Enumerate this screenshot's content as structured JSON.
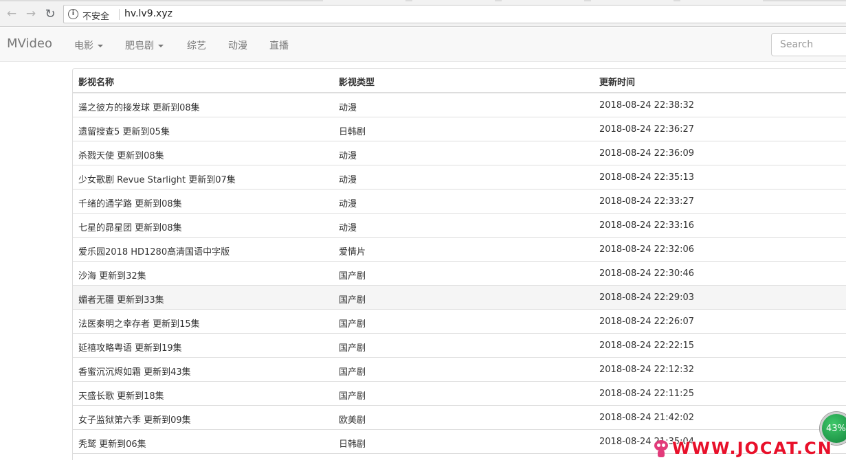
{
  "browser": {
    "back_icon": "back-arrow-icon",
    "forward_icon": "forward-arrow-icon",
    "reload_icon": "reload-icon",
    "security_label": "不安全",
    "url": "hv.lv9.xyz"
  },
  "navbar": {
    "brand": "MVideo",
    "items": [
      {
        "label": "电影",
        "dropdown": true
      },
      {
        "label": "肥皂剧",
        "dropdown": true
      },
      {
        "label": "综艺",
        "dropdown": false
      },
      {
        "label": "动漫",
        "dropdown": false
      },
      {
        "label": "直播",
        "dropdown": false
      }
    ],
    "search_placeholder": "Search"
  },
  "table": {
    "headers": [
      "影视名称",
      "影视类型",
      "更新时间"
    ],
    "rows": [
      {
        "name": "遥之彼方的接发球 更新到08集",
        "type": "动漫",
        "time": "2018-08-24 22:38:32"
      },
      {
        "name": "遗留搜查5 更新到05集",
        "type": "日韩剧",
        "time": "2018-08-24 22:36:27"
      },
      {
        "name": "杀戮天使 更新到08集",
        "type": "动漫",
        "time": "2018-08-24 22:36:09"
      },
      {
        "name": "少女歌剧 Revue Starlight 更新到07集",
        "type": "动漫",
        "time": "2018-08-24 22:35:13"
      },
      {
        "name": "千绪的通学路 更新到08集",
        "type": "动漫",
        "time": "2018-08-24 22:33:27"
      },
      {
        "name": "七星的昴星团 更新到08集",
        "type": "动漫",
        "time": "2018-08-24 22:33:16"
      },
      {
        "name": "爱乐园2018 HD1280高清国语中字版",
        "type": "爱情片",
        "time": "2018-08-24 22:32:06"
      },
      {
        "name": "沙海 更新到32集",
        "type": "国产剧",
        "time": "2018-08-24 22:30:46"
      },
      {
        "name": "媚者无疆 更新到33集",
        "type": "国产剧",
        "time": "2018-08-24 22:29:03"
      },
      {
        "name": "法医秦明之幸存者 更新到15集",
        "type": "国产剧",
        "time": "2018-08-24 22:26:07"
      },
      {
        "name": "延禧攻略粤语 更新到19集",
        "type": "国产剧",
        "time": "2018-08-24 22:22:15"
      },
      {
        "name": "香蜜沉沉烬如霜 更新到43集",
        "type": "国产剧",
        "time": "2018-08-24 22:12:32"
      },
      {
        "name": "天盛长歌 更新到18集",
        "type": "国产剧",
        "time": "2018-08-24 22:11:25"
      },
      {
        "name": "女子监狱第六季 更新到09集",
        "type": "欧美剧",
        "time": "2018-08-24 21:42:02"
      },
      {
        "name": "秃鹫 更新到06集",
        "type": "日韩剧",
        "time": "2018-08-24 21:35:04"
      }
    ],
    "hover_row_index": 8
  },
  "overlay": {
    "progress_badge": "43%",
    "watermark": "WWW.JOCAT.CN"
  },
  "colors": {
    "navbar_bg": "#f8f8f8",
    "row_hover": "#f5f5f5",
    "badge_green": "#1a9a45",
    "watermark_red": "#e8102a"
  }
}
